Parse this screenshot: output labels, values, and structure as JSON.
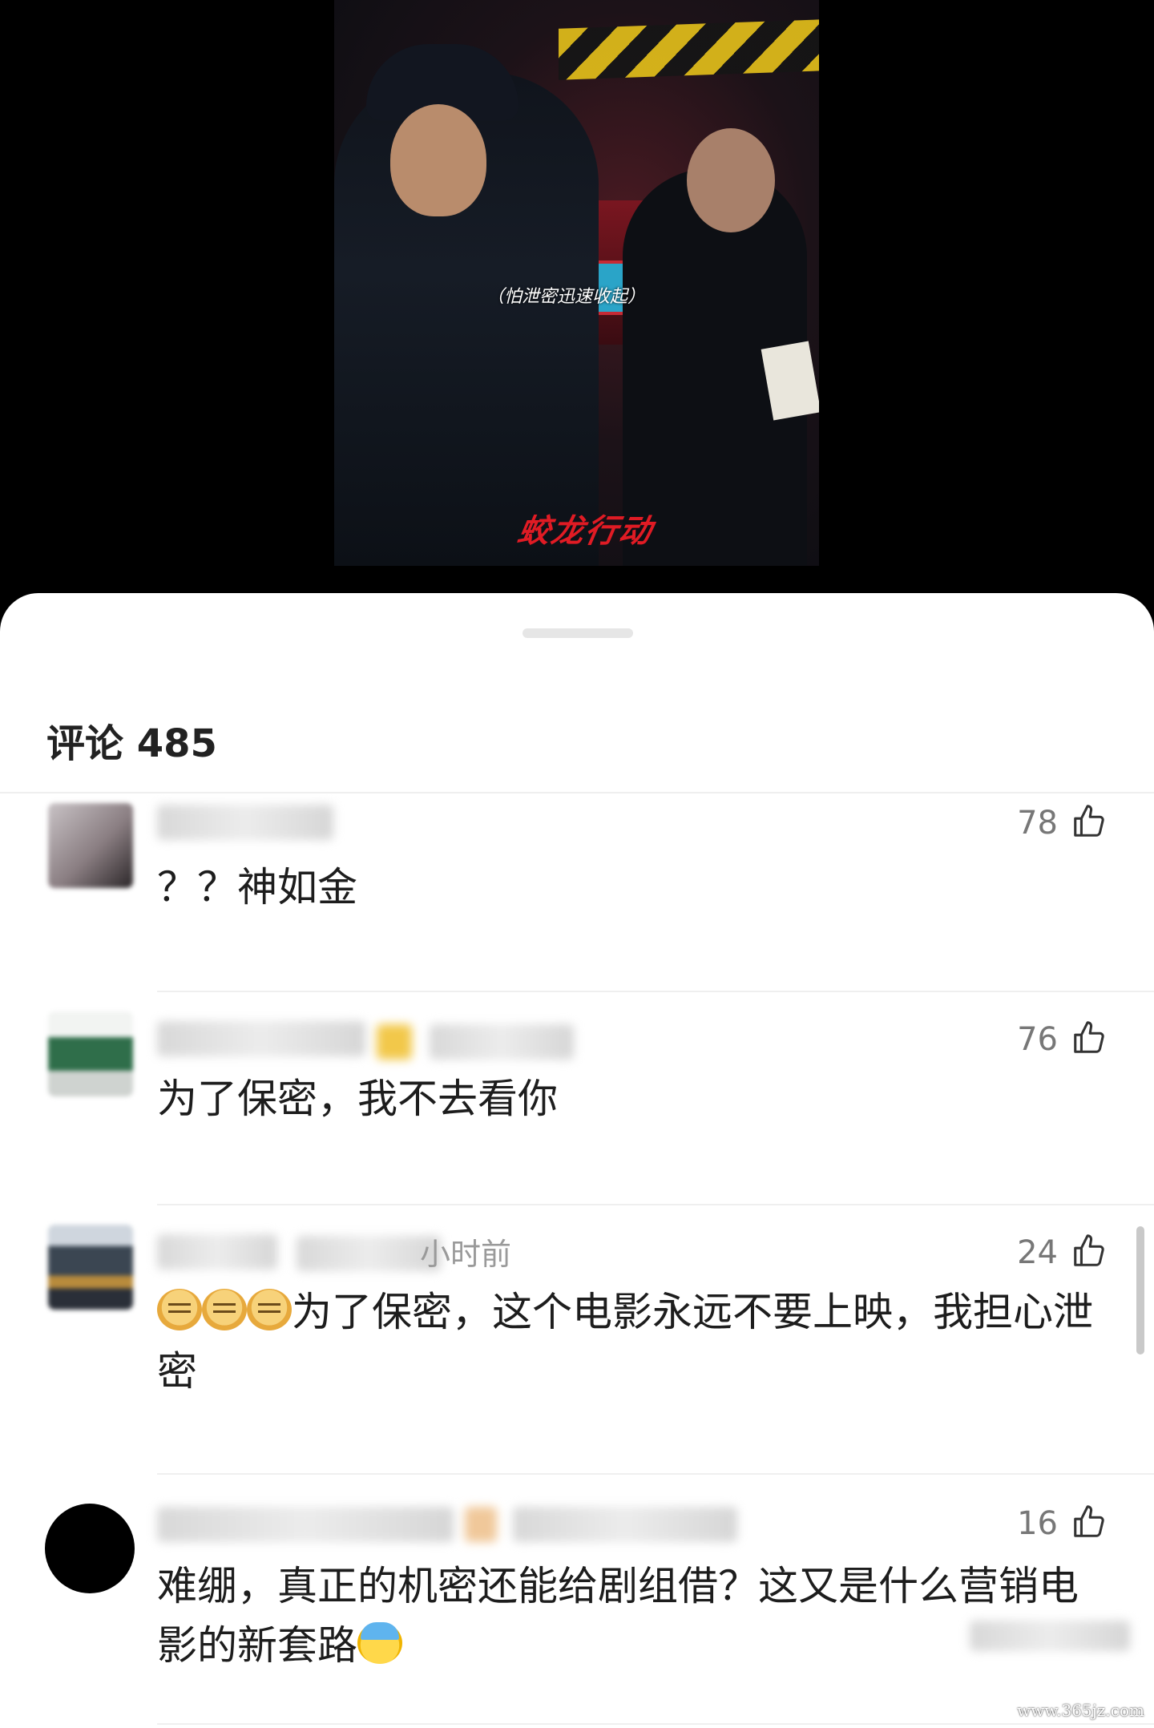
{
  "video": {
    "subtitle": "（怕泄密迅速收起）",
    "logo_text": "蛟龙行动"
  },
  "comments_header": {
    "label": "评论 485"
  },
  "comments": [
    {
      "meta_suffix": "",
      "likes": "78",
      "text": "？？神如金"
    },
    {
      "meta_suffix": "",
      "likes": "76",
      "text": "为了保密，我不去看你"
    },
    {
      "meta_suffix": "小时前",
      "likes": "24",
      "text": "为了保密，这个电影永远不要上映，我担心泄密",
      "emoji_prefix": [
        "doge-emoji",
        "doge-emoji",
        "doge-emoji"
      ]
    },
    {
      "meta_suffix": "",
      "likes": "16",
      "text": "难绷，真正的机密还能给剧组借？这又是什么营销电影的新套路",
      "emoji_suffix": [
        "sweat-emoji"
      ]
    }
  ],
  "watermark": "www.365jz.com",
  "icons": {
    "like": "thumbs-up-icon"
  }
}
